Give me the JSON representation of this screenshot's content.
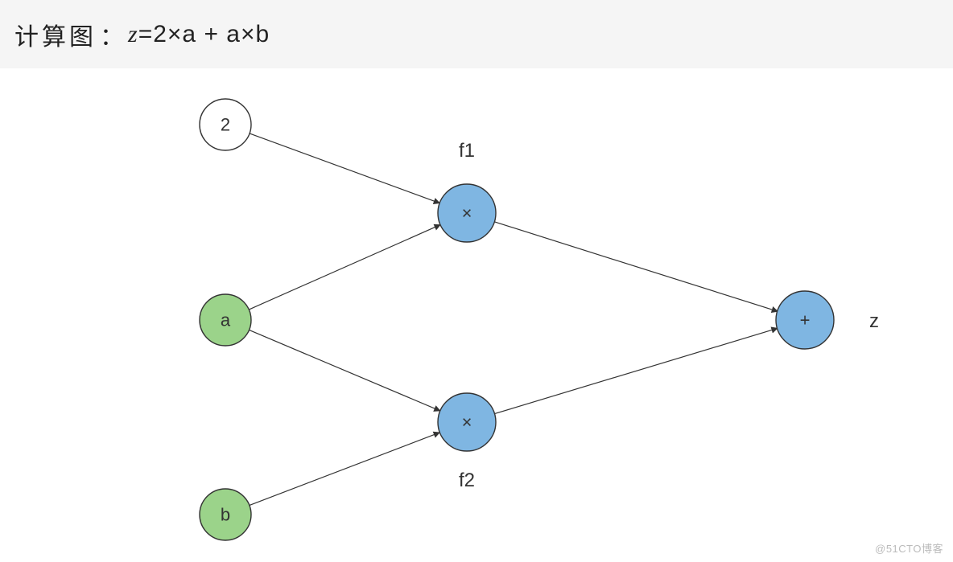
{
  "title": {
    "prefix": "计算图",
    "sep": "：",
    "var_z": "z",
    "eq": " = ",
    "expr_rest": "2×a + a×b"
  },
  "nodes": {
    "const2": {
      "label": "2"
    },
    "a": {
      "label": "a"
    },
    "b": {
      "label": "b"
    },
    "f1": {
      "op": "×",
      "anno": "f1"
    },
    "f2": {
      "op": "×",
      "anno": "f2"
    },
    "plus": {
      "op": "+",
      "anno": "z"
    }
  },
  "watermark": "@51CTO博客"
}
